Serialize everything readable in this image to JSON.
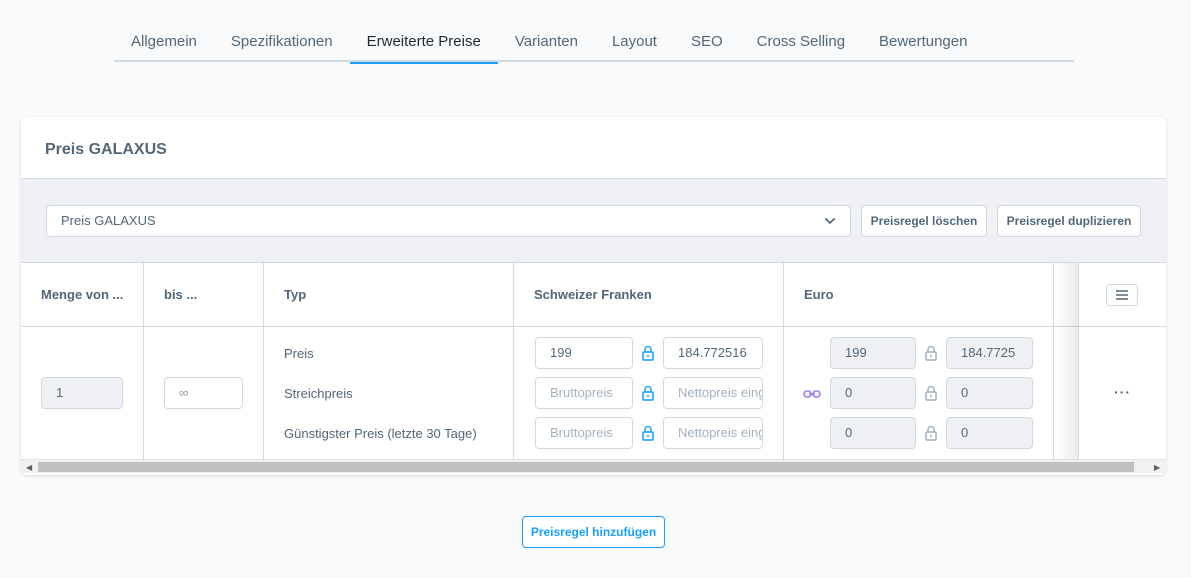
{
  "tabs": [
    {
      "label": "Allgemein"
    },
    {
      "label": "Spezifikationen"
    },
    {
      "label": "Erweiterte Preise"
    },
    {
      "label": "Varianten"
    },
    {
      "label": "Layout"
    },
    {
      "label": "SEO"
    },
    {
      "label": "Cross Selling"
    },
    {
      "label": "Bewertungen"
    }
  ],
  "active_tab": "Erweiterte Preise",
  "card": {
    "title": "Preis GALAXUS",
    "rule_select": "Preis GALAXUS",
    "delete_button": "Preisregel löschen",
    "duplicate_button": "Preisregel duplizieren"
  },
  "table": {
    "headers": {
      "qty_from": "Menge von ...",
      "qty_to": "bis ...",
      "type": "Typ",
      "chf": "Schweizer Franken",
      "eur": "Euro"
    },
    "qty_from_value": "1",
    "qty_to_value": "∞",
    "rows": [
      {
        "type": "Preis",
        "chf_gross": "199",
        "chf_net": "184.772516",
        "eur_gross": "199",
        "eur_net": "184.7725"
      },
      {
        "type": "Streichpreis",
        "chf_gross_placeholder": "Bruttopreis",
        "chf_net_placeholder": "Nettopreis eingeben",
        "eur_gross": "0",
        "eur_net": "0"
      },
      {
        "type": "Günstigster Preis (letzte 30 Tage)",
        "chf_gross_placeholder": "Bruttopreis",
        "chf_net_placeholder": "Nettopreis eingeben",
        "eur_gross": "0",
        "eur_net": "0"
      }
    ],
    "row_actions": "···"
  },
  "add_button": "Preisregel hinzufügen",
  "colors": {
    "accent": "#189eff",
    "text": "#52667a",
    "border": "#d1d9e0",
    "link_icon": "#9d7cf2"
  }
}
